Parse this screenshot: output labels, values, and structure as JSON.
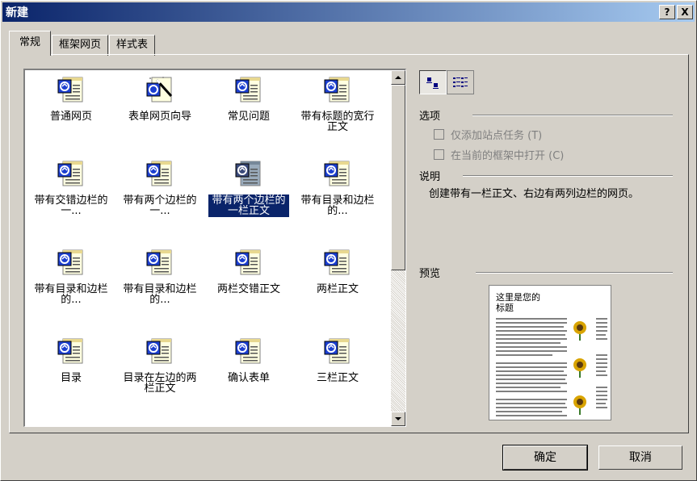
{
  "window": {
    "title": "新建",
    "help_label": "?",
    "close_label": "X"
  },
  "tabs": [
    {
      "label": "常规",
      "active": true
    },
    {
      "label": "框架网页",
      "active": false
    },
    {
      "label": "样式表",
      "active": false
    }
  ],
  "templates": [
    {
      "label": "普通网页",
      "icon": "page-template-icon"
    },
    {
      "label": "表单网页向导",
      "icon": "wizard-template-icon"
    },
    {
      "label": "常见问题",
      "icon": "page-template-icon"
    },
    {
      "label": "带有标题的宽行正文",
      "icon": "page-template-icon"
    },
    {
      "label": "带有交错边栏的一...",
      "icon": "page-template-icon"
    },
    {
      "label": "带有两个边栏的一...",
      "icon": "page-template-icon"
    },
    {
      "label": "带有两个边栏的一栏正文",
      "icon": "page-template-icon",
      "selected": true
    },
    {
      "label": "带有目录和边栏的...",
      "icon": "page-template-icon"
    },
    {
      "label": "带有目录和边栏的...",
      "icon": "page-template-icon"
    },
    {
      "label": "带有目录和边栏的...",
      "icon": "page-template-icon"
    },
    {
      "label": "两栏交错正文",
      "icon": "page-template-icon"
    },
    {
      "label": "两栏正文",
      "icon": "page-template-icon"
    },
    {
      "label": "目录",
      "icon": "page-template-icon"
    },
    {
      "label": "目录在左边的两栏正文",
      "icon": "page-template-icon"
    },
    {
      "label": "确认表单",
      "icon": "page-template-icon"
    },
    {
      "label": "三栏正文",
      "icon": "page-template-icon"
    }
  ],
  "options": {
    "group_label": "选项",
    "add_task_label": "仅添加站点任务 (T)",
    "open_in_frame_label": "在当前的框架中打开 (C)"
  },
  "description": {
    "group_label": "说明",
    "text": "创建带有一栏正文、右边有两列边栏的网页。"
  },
  "preview": {
    "group_label": "预览",
    "title_text": "这里是您的\n标题"
  },
  "buttons": {
    "ok_label": "确定",
    "cancel_label": "取消"
  },
  "colors": {
    "titlebar_start": "#0a246a",
    "titlebar_end": "#a6caf0",
    "selection": "#0a246a",
    "face": "#d4d0c8"
  }
}
